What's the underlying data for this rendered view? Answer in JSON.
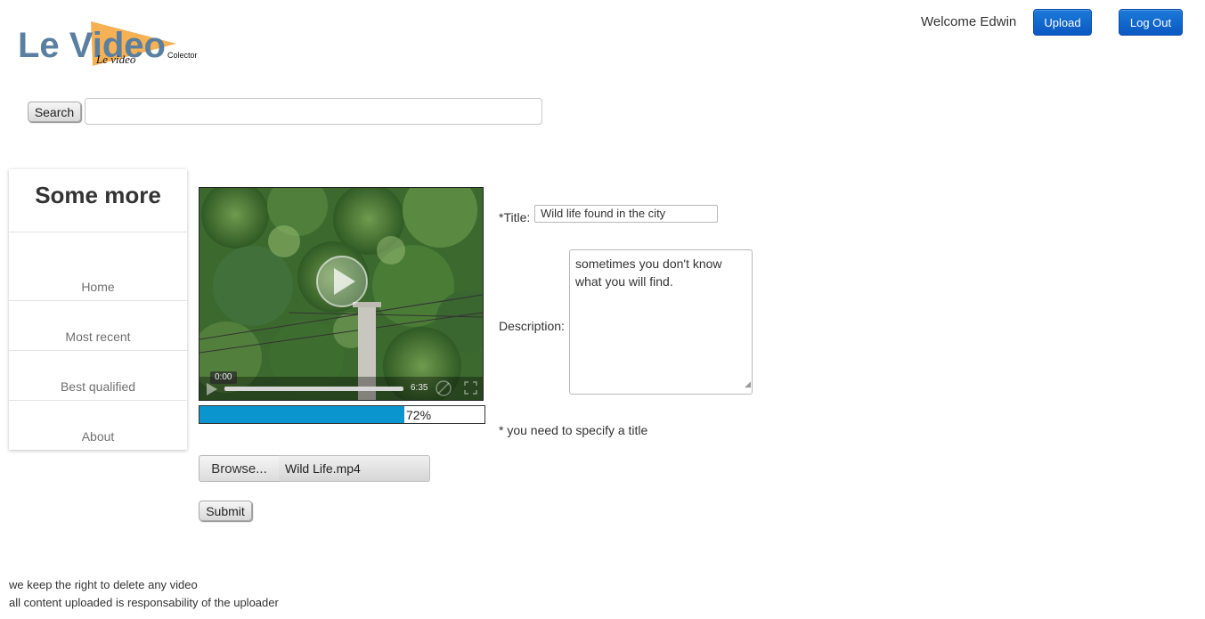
{
  "logo": {
    "text": "Le Video",
    "tagline": "Le video",
    "tagline_small": "Colector"
  },
  "header": {
    "welcome": "Welcome Edwin",
    "upload_label": "Upload",
    "logout_label": "Log Out"
  },
  "search": {
    "button_label": "Search",
    "value": ""
  },
  "sidebar": {
    "title": "Some more",
    "items": [
      {
        "label": "Home"
      },
      {
        "label": "Most recent"
      },
      {
        "label": "Best qualified"
      },
      {
        "label": "About"
      }
    ]
  },
  "video": {
    "current_time": "0:00",
    "duration": "6:35"
  },
  "upload_progress": {
    "percent": 72,
    "label": "72%"
  },
  "file": {
    "browse_label": "Browse...",
    "file_name": "Wild Life.mp4"
  },
  "form": {
    "title_label": "*Title:",
    "title_value": "Wild life found in the city",
    "description_label": "Description:",
    "description_value": "sometimes you don't know what you will find.",
    "hint": "* you need to specify a title",
    "submit_label": "Submit"
  },
  "footer": {
    "line1": "we keep the right to delete any video",
    "line2": "all content uploaded is responsability of the uploader"
  },
  "colors": {
    "primary_button": "#0b58c2",
    "progress_fill": "#0b95cf",
    "logo_text": "#5a7fa0",
    "logo_triangle": "#f4a940"
  }
}
